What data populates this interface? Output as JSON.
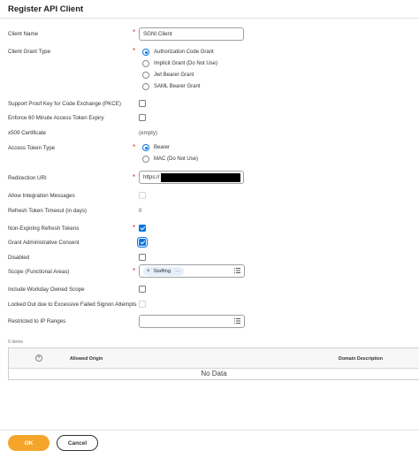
{
  "page": {
    "title": "Register API Client"
  },
  "form": {
    "client_name": {
      "label": "Client Name",
      "value": "SGNI Client"
    },
    "grant_type": {
      "label": "Client Grant Type",
      "options": [
        {
          "label": "Authorization Code Grant",
          "selected": true
        },
        {
          "label": "Implicit Grant (Do Not Use)",
          "selected": false
        },
        {
          "label": "Jwt Bearer Grant",
          "selected": false
        },
        {
          "label": "SAML Bearer Grant",
          "selected": false
        }
      ]
    },
    "pkce": {
      "label": "Support Proof Key for Code Exchange (PKCE)",
      "checked": false
    },
    "enforce_expiry": {
      "label": "Enforce 60 Minute Access Token Expiry",
      "checked": false
    },
    "x509": {
      "label": "x509 Certificate",
      "value": "(empty)"
    },
    "access_token_type": {
      "label": "Access Token Type",
      "options": [
        {
          "label": "Bearer",
          "selected": true
        },
        {
          "label": "MAC (Do Not Use)",
          "selected": false
        }
      ]
    },
    "redirection_uri": {
      "label": "Redirection URI",
      "value": "https://"
    },
    "allow_integration_messages": {
      "label": "Allow Integration Messages",
      "checked": false
    },
    "refresh_token_timeout": {
      "label": "Refresh Token Timeout (in days)",
      "value": "0"
    },
    "non_expiring_refresh": {
      "label": "Non-Expiring Refresh Tokens",
      "checked": true
    },
    "grant_admin_consent": {
      "label": "Grant Administrative Consent",
      "checked": true
    },
    "disabled": {
      "label": "Disabled",
      "checked": false
    },
    "scope": {
      "label": "Scope (Functional Areas)",
      "pill": "Staffing",
      "remove_glyph": "×",
      "more_glyph": "···"
    },
    "include_workday_scope": {
      "label": "Include Workday Owned Scope",
      "checked": false
    },
    "locked_out": {
      "label": "Locked Out due to Excessive Failed Signon Attempts",
      "checked": false
    },
    "restricted_ip": {
      "label": "Restricted to IP Ranges",
      "value": ""
    },
    "required_marker": "*"
  },
  "grid": {
    "items_count": "0 items",
    "add_glyph": "+",
    "columns": [
      "Allowed Origin",
      "Domain Description"
    ],
    "empty_text": "No Data"
  },
  "footer": {
    "ok_label": "OK",
    "cancel_label": "Cancel"
  },
  "colors": {
    "accent_blue": "#0875e1",
    "ok_orange": "#f6a52b",
    "required_red": "#de2e21",
    "redaction": "#000000"
  },
  "icons": {
    "prompt_icon": "list-icon",
    "add_row_icon": "plus-circle-icon"
  }
}
